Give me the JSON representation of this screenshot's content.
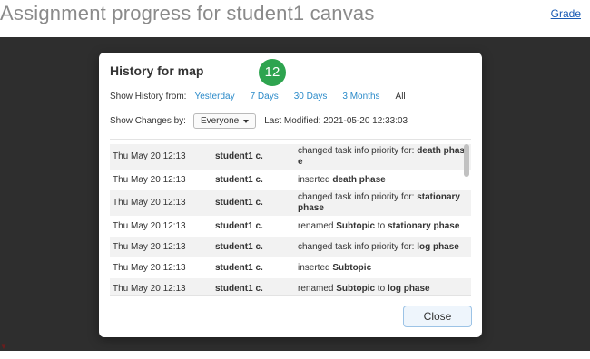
{
  "page": {
    "title": "Assignment progress for student1 canvas",
    "grade_link": "Grade"
  },
  "modal": {
    "title": "History for map",
    "badge_count": "12",
    "show_history_label": "Show History from:",
    "history_options": [
      "Yesterday",
      "7 Days",
      "30 Days",
      "3 Months",
      "All"
    ],
    "active_history_option": "All",
    "show_changes_label": "Show Changes by:",
    "changes_by_selected": "Everyone",
    "last_modified": "Last Modified: 2021-05-20 12:33:03",
    "close_label": "Close"
  },
  "history": [
    {
      "date": "Thu May 20 12:13",
      "user": "student1 c.",
      "action": "changed task info priority for: ",
      "target": "death phase"
    },
    {
      "date": "Thu May 20 12:13",
      "user": "student1 c.",
      "action": "inserted ",
      "target": "death phase"
    },
    {
      "date": "Thu May 20 12:13",
      "user": "student1 c.",
      "action": "changed task info priority for: ",
      "target": "stationary phase"
    },
    {
      "date": "Thu May 20 12:13",
      "user": "student1 c.",
      "action": "renamed ",
      "target": "Subtopic",
      "action2": " to ",
      "target2": "stationary phase"
    },
    {
      "date": "Thu May 20 12:13",
      "user": "student1 c.",
      "action": "changed task info priority for: ",
      "target": "log phase"
    },
    {
      "date": "Thu May 20 12:13",
      "user": "student1 c.",
      "action": "inserted ",
      "target": "Subtopic"
    },
    {
      "date": "Thu May 20 12:13",
      "user": "student1 c.",
      "action": "renamed ",
      "target": "Subtopic",
      "action2": " to ",
      "target2": "log phase"
    }
  ],
  "colors": {
    "overlay": "#2e2e2e",
    "badge": "#2ea44f",
    "link": "#2a8ac9"
  }
}
